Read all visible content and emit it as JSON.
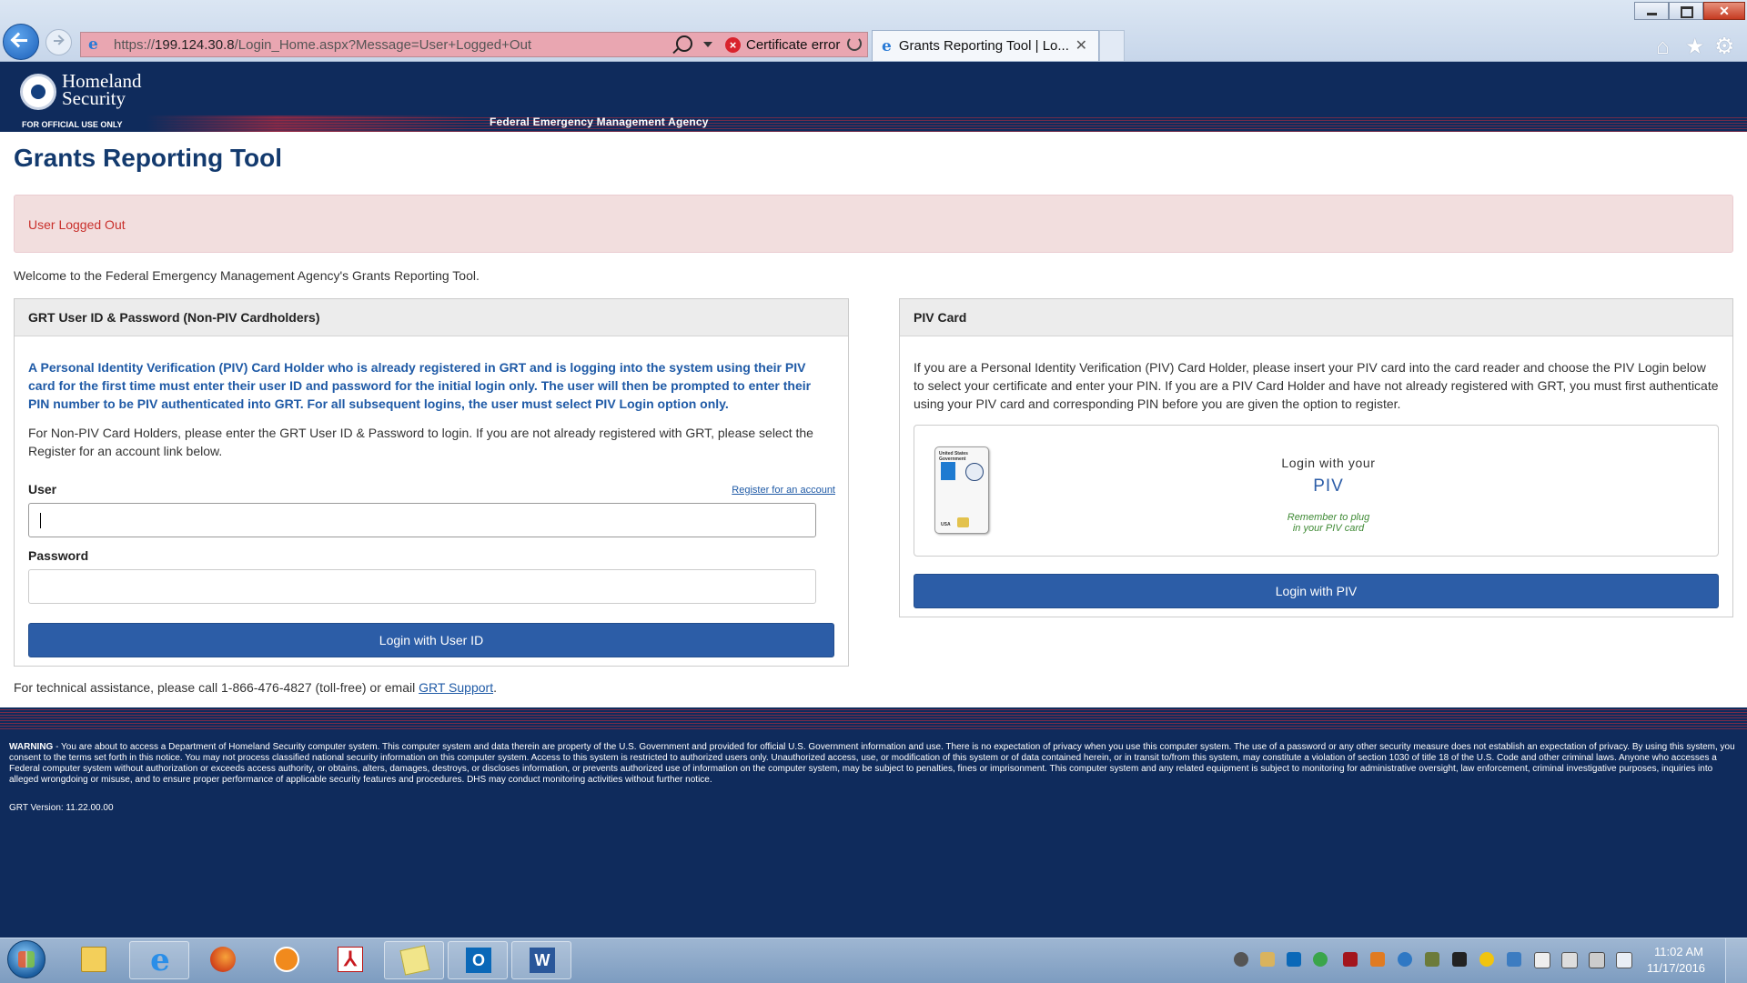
{
  "browser": {
    "url_prefix": "https://",
    "url_host": "199.124.30.8",
    "url_path": "/Login_Home.aspx?Message=User+Logged+Out",
    "cert_error": "Certificate error",
    "tab_title": "Grants Reporting Tool | Lo...",
    "tab_close": "✕",
    "win_close": "✕"
  },
  "header": {
    "agency_line1": "Homeland",
    "agency_line2": "Security",
    "official_use": "FOR OFFICIAL USE ONLY",
    "sub_agency": "Federal Emergency Management Agency"
  },
  "main": {
    "title": "Grants Reporting Tool",
    "alert": "User Logged Out",
    "welcome": "Welcome to the Federal Emergency Management Agency's Grants Reporting Tool.",
    "left_panel": {
      "heading": "GRT User ID & Password (Non-PIV Cardholders)",
      "piv_notice": "A Personal Identity Verification (PIV) Card Holder who is already registered in GRT and is logging into the system using their PIV card for the first time must enter their user ID and password for the initial login only. The user will then be prompted to enter their PIN number to be PIV authenticated into GRT. For all subsequent logins, the user must select PIV Login option only.",
      "nonpiv_text": "For Non-PIV Card Holders, please enter the GRT User ID & Password to login. If you are not already registered with GRT, please select the Register for an account link below.",
      "user_label": "User",
      "register_link": "Register for an account",
      "user_value": "",
      "password_label": "Password",
      "password_value": "",
      "login_button": "Login with User ID"
    },
    "right_panel": {
      "heading": "PIV Card",
      "description": "If you are a Personal Identity Verification (PIV) Card Holder, please insert your PIV card into the card reader and choose the PIV Login below to select your certificate and enter your PIN. If you are a PIV Card Holder and have not already registered with GRT, you must first authenticate using your PIV card and corresponding PIN before you are given the option to register.",
      "card_header": "United States Government",
      "card_country": "USA",
      "login_line1": "Login with your",
      "login_line2": "PIV",
      "reminder": "Remember to plug in your PIV card",
      "login_button": "Login with PIV"
    },
    "tech_assist_prefix": "For technical assistance, please call 1-866-476-4827 (toll-free) or email ",
    "tech_assist_link": "GRT Support",
    "tech_assist_suffix": "."
  },
  "footer": {
    "warning_label": "WARNING",
    "warning_text": " - You are about to access a Department of Homeland Security computer system. This computer system and data therein are property of the U.S. Government and provided for official U.S. Government information and use. There is no expectation of privacy when you use this computer system. The use of a password or any other security measure does not establish an expectation of privacy. By using this system, you consent to the terms set forth in this notice. You may not process classified national security information on this computer system. Access to this system is restricted to authorized users only. Unauthorized access, use, or modification of this system or of data contained herein, or in transit to/from this system, may constitute a violation of section 1030 of title 18 of the U.S. Code and other criminal laws. Anyone who accesses a Federal computer system without authorization or exceeds access authority, or obtains, alters, damages, destroys, or discloses information, or prevents authorized use of information on the computer system, may be subject to penalties, fines or imprisonment. This computer system and any related equipment is subject to monitoring for administrative oversight, law enforcement, criminal investigative purposes, inquiries into alleged wrongdoing or misuse, and to ensure proper performance of applicable security features and procedures. DHS may conduct monitoring activities without further notice.",
    "version": "GRT Version: 11.22.00.00"
  },
  "taskbar": {
    "apps": [
      "windows-explorer",
      "internet-explorer",
      "firefox",
      "media-player",
      "adobe-acrobat",
      "sticky-notes",
      "outlook",
      "word"
    ],
    "outlook_glyph": "O",
    "word_glyph": "W",
    "time": "11:02 AM",
    "date": "11/17/2016"
  },
  "colors": {
    "header_navy": "#0f2b5c",
    "title_blue": "#133a6e",
    "button_blue": "#2c5da7",
    "alert_bg": "#f2dede",
    "alert_text": "#c9302c",
    "address_error": "#e9a6b1"
  }
}
